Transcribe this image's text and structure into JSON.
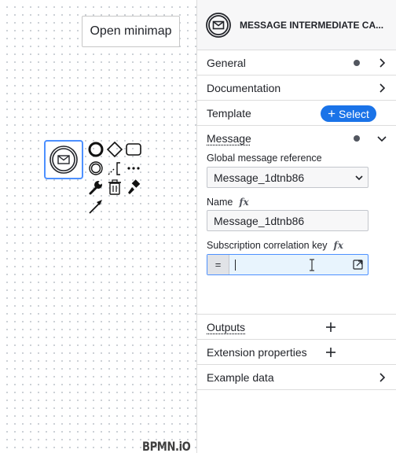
{
  "canvas": {
    "minimap_button": "Open minimap",
    "watermark": "BPMN.iO",
    "context_pad": [
      "end-event-icon",
      "gateway-icon",
      "task-icon",
      "intermediate-event-icon",
      "text-annotation-icon",
      "more-icon",
      "wrench-icon",
      "trash-icon",
      "paint-icon",
      "connect-arrow-icon"
    ]
  },
  "panel": {
    "header_title": "MESSAGE INTERMEDIATE CA...",
    "groups": {
      "general": "General",
      "documentation": "Documentation",
      "template": "Template",
      "template_action": "Select",
      "message": "Message",
      "outputs": "Outputs",
      "extension_properties": "Extension properties",
      "example_data": "Example data"
    },
    "message": {
      "global_ref_label": "Global message reference",
      "global_ref_value": "Message_1dtnb86",
      "name_label": "Name",
      "name_value": "Message_1dtnb86",
      "correlation_label": "Subscription correlation key",
      "correlation_value": "",
      "feel_prefix": "=",
      "fx": "fx"
    }
  },
  "colors": {
    "accent": "#1a73e8",
    "selection": "#4d90ff",
    "field_focus_bg": "#e8f4fd"
  }
}
